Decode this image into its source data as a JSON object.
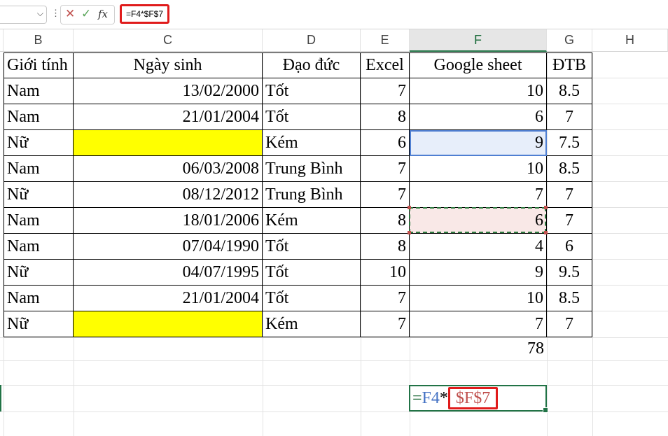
{
  "formula_bar": {
    "name_box": "",
    "cancel_icon": "✕",
    "enter_icon": "✓",
    "fx_label": "fx",
    "formula": "=F4*$F$7"
  },
  "columns": [
    "B",
    "C",
    "D",
    "E",
    "F",
    "G",
    "H"
  ],
  "selected_column": "F",
  "table": {
    "headers": [
      "Giới tính",
      "Ngày sinh",
      "Đạo đức",
      "Excel",
      "Google sheet",
      "ĐTB"
    ],
    "rows": [
      [
        "Nam",
        "13/02/2000",
        "Tốt",
        "7",
        "10",
        "8.5"
      ],
      [
        "Nam",
        "21/01/2004",
        "Tốt",
        "8",
        "6",
        "7"
      ],
      [
        "Nữ",
        "",
        "Kém",
        "6",
        "9",
        "7.5"
      ],
      [
        "Nam",
        "06/03/2008",
        "Trung Bình",
        "7",
        "10",
        "8.5"
      ],
      [
        "Nữ",
        "08/12/2012",
        "Trung Bình",
        "7",
        "7",
        "7"
      ],
      [
        "Nam",
        "18/01/2006",
        "Kém",
        "8",
        "6",
        "7"
      ],
      [
        "Nam",
        "07/04/1990",
        "Tốt",
        "8",
        "4",
        "6"
      ],
      [
        "Nữ",
        "04/07/1995",
        "Tốt",
        "10",
        "9",
        "9.5"
      ],
      [
        "Nam",
        "21/01/2004",
        "Tốt",
        "7",
        "10",
        "8.5"
      ],
      [
        "Nữ",
        "",
        "Kém",
        "7",
        "7",
        "7"
      ]
    ],
    "total": "78"
  },
  "edit_cell": {
    "eq": "=",
    "ref1": "F4",
    "op": "*",
    "ref2": "$F$7"
  },
  "colors": {
    "accent": "#217346",
    "highlight_red": "#e01b1b",
    "yellow": "#ffff00",
    "ref_blue": "#4472c4",
    "ref_red": "#c0504d"
  }
}
